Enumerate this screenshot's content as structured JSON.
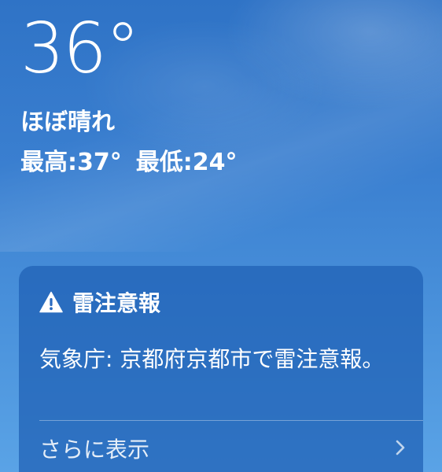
{
  "current": {
    "temperature": "36°",
    "condition": "ほぼ晴れ",
    "high": "最高:37°",
    "low": "最低:24°"
  },
  "alert": {
    "icon": "warning-triangle-icon",
    "title": "雷注意報",
    "body": "気象庁: 京都府京都市で雷注意報。",
    "more_label": "さらに表示",
    "more_icon": "chevron-right-icon"
  }
}
